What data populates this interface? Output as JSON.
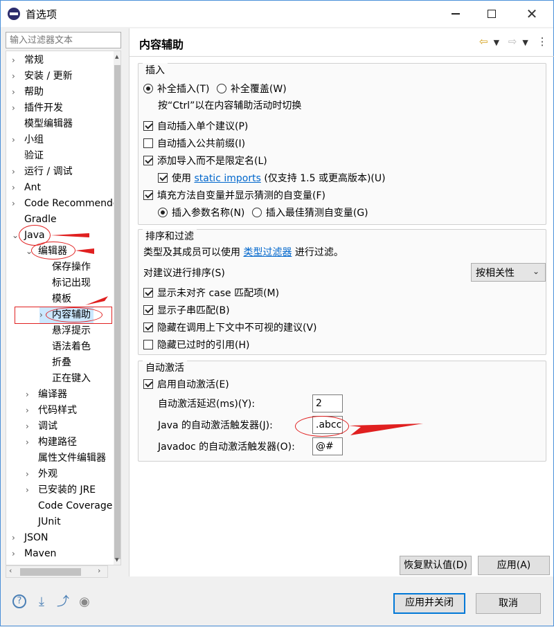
{
  "window": {
    "title": "首选项"
  },
  "filter": {
    "placeholder": "输入过滤器文本"
  },
  "tree": {
    "items": [
      {
        "label": "常规"
      },
      {
        "label": "安装 / 更新"
      },
      {
        "label": "帮助"
      },
      {
        "label": "插件开发"
      },
      {
        "label": "模型编辑器"
      },
      {
        "label": "小组"
      },
      {
        "label": "验证"
      },
      {
        "label": "运行 / 调试"
      },
      {
        "label": "Ant"
      },
      {
        "label": "Code Recommenders"
      },
      {
        "label": "Gradle"
      },
      {
        "label": "Java"
      },
      {
        "label": "编辑器"
      },
      {
        "label": "保存操作"
      },
      {
        "label": "标记出现"
      },
      {
        "label": "模板"
      },
      {
        "label": "内容辅助"
      },
      {
        "label": "悬浮提示"
      },
      {
        "label": "语法着色"
      },
      {
        "label": "折叠"
      },
      {
        "label": "正在键入"
      },
      {
        "label": "编译器"
      },
      {
        "label": "代码样式"
      },
      {
        "label": "调试"
      },
      {
        "label": "构建路径"
      },
      {
        "label": "属性文件编辑器"
      },
      {
        "label": "外观"
      },
      {
        "label": "已安装的 JRE"
      },
      {
        "label": "Code Coverage"
      },
      {
        "label": "JUnit"
      },
      {
        "label": "JSON"
      },
      {
        "label": "Maven"
      }
    ]
  },
  "panel": {
    "title": "内容辅助",
    "insert_group": {
      "label": "插入",
      "radio_complete_insert": "补全插入(T)",
      "radio_complete_overwrite": "补全覆盖(W)",
      "ctrl_hint": "按“Ctrl”以在内容辅助活动时切换",
      "auto_insert_single": "自动插入单个建议(P)",
      "auto_insert_prefix": "自动插入公共前缀(I)",
      "add_import": "添加导入而不是限定名(L)",
      "use_prefix": "使用",
      "static_imports": "static imports",
      "static_imports_suffix": "(仅支持 1.5 或更高版本)(U)",
      "fill_method_args": "填充方法自变量并显示猜测的自变量(F)",
      "insert_param_names": "插入参数名称(N)",
      "insert_best_guess": "插入最佳猜测自变量(G)"
    },
    "sort_group": {
      "label": "排序和过滤",
      "filter_desc_prefix": "类型及其成员可以使用",
      "type_filter_link": "类型过滤器",
      "filter_desc_suffix": "进行过滤。",
      "sort_label": "对建议进行排序(S)",
      "sort_value": "按相关性",
      "show_camel_case": "显示未对齐 case 匹配项(M)",
      "show_substring": "显示子串匹配(B)",
      "hide_invisible": "隐藏在调用上下文中不可视的建议(V)",
      "hide_deprecated": "隐藏已过时的引用(H)"
    },
    "auto_group": {
      "label": "自动激活",
      "enable_auto": "启用自动激活(E)",
      "delay_label": "自动激活延迟(ms)(Y):",
      "delay_value": "2",
      "java_trigger_label": "Java 的自动激活触发器(J):",
      "java_trigger_value": ".abcc",
      "javadoc_trigger_label": "Javadoc 的自动激活触发器(O):",
      "javadoc_trigger_value": "@#"
    },
    "restore_defaults": "恢复默认值(D)",
    "apply": "应用(A)"
  },
  "footer": {
    "apply_close": "应用并关闭",
    "cancel": "取消"
  },
  "colors": {
    "annotation": "#e02020",
    "link": "#0066cc",
    "focus": "#0078d7"
  }
}
